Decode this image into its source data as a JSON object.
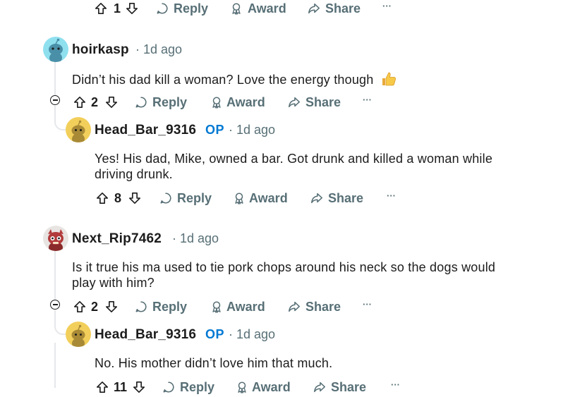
{
  "actions": {
    "reply": "Reply",
    "award": "Award",
    "share": "Share",
    "more": "···"
  },
  "top_actions": {
    "votes": "1"
  },
  "comments": [
    {
      "author": "hoirkasp",
      "op": "",
      "time": "1d ago",
      "body": "Didn’t his dad kill a woman? Love the energy though",
      "votes": "2",
      "reply": {
        "author": "Head_Bar_9316",
        "op": "OP",
        "time": "1d ago",
        "body_line1": "Yes! His dad, Mike, owned a bar. Got drunk and killed a woman while",
        "body_line2": "driving drunk.",
        "votes": "8"
      }
    },
    {
      "author": "Next_Rip7462",
      "op": "",
      "time": "1d ago",
      "body_line1": "Is it true his ma used to tie pork chops around his neck so the dogs would",
      "body_line2": "play with him?",
      "votes": "2",
      "reply": {
        "author": "Head_Bar_9316",
        "op": "OP",
        "time": "1d ago",
        "body": "No. His mother didn’t love him that much.",
        "votes": "11"
      }
    }
  ],
  "colors": {
    "op": "#0079d3",
    "meta": "#576f76",
    "thread": "#e5e7ea"
  }
}
